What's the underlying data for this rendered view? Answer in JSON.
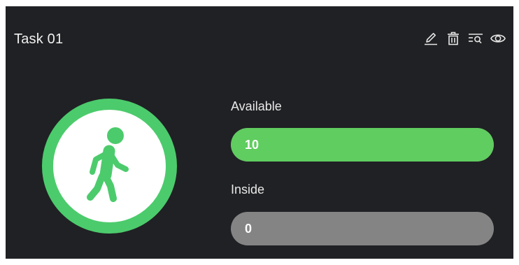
{
  "task": {
    "title": "Task 01"
  },
  "toolbar": {
    "icons": [
      "edit-icon",
      "delete-icon",
      "search-list-icon",
      "view-icon"
    ]
  },
  "status": {
    "icon": "walking-person-icon",
    "color": "#4ccb6c"
  },
  "available": {
    "label": "Available",
    "value": "10",
    "fill_fraction": 1.0,
    "color": "#5fcd5f"
  },
  "inside": {
    "label": "Inside",
    "value": "0",
    "fill_fraction": 0.0,
    "color": "#848484"
  }
}
